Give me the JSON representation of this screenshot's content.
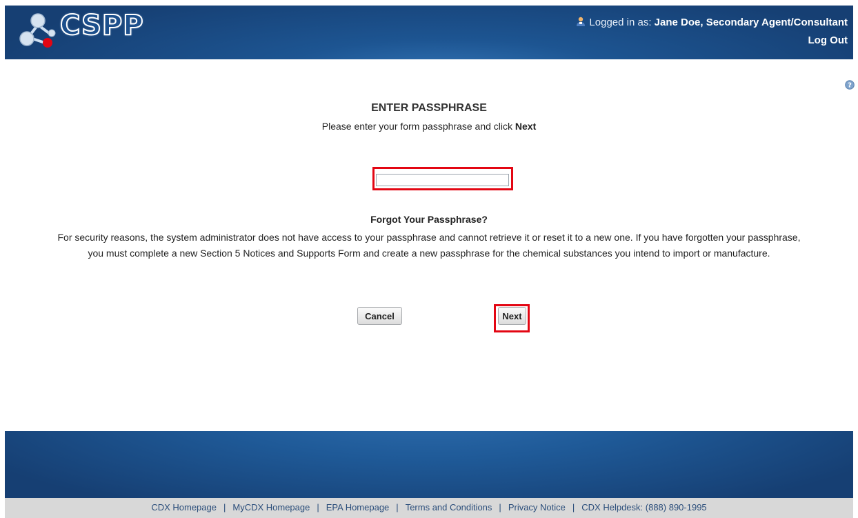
{
  "header": {
    "app_name": "CSPP",
    "logged_in_label": "Logged in as:",
    "user_name": "Jane Doe, Secondary Agent/Consultant",
    "logout_label": "Log Out"
  },
  "page": {
    "title": "ENTER PASSPHRASE",
    "instruction_text": "Please enter your form passphrase and click",
    "instruction_bold": "Next",
    "passphrase_value": "",
    "forgot_title": "Forgot Your Passphrase?",
    "forgot_body": "For security reasons, the system administrator does not have access to your passphrase and cannot retrieve it or reset it to a new one. If you have forgotten your passphrase, you must complete a new Section 5 Notices and Supports Form and create a new passphrase for the chemical substances you intend to import or manufacture.",
    "cancel_label": "Cancel",
    "next_label": "Next"
  },
  "footer": {
    "links": [
      "CDX Homepage",
      "MyCDX Homepage",
      "EPA Homepage",
      "Terms and Conditions",
      "Privacy Notice"
    ],
    "helpdesk": "CDX Helpdesk: (888) 890-1995"
  },
  "colors": {
    "highlight": "#e30613",
    "header_blue": "#1d5592"
  }
}
